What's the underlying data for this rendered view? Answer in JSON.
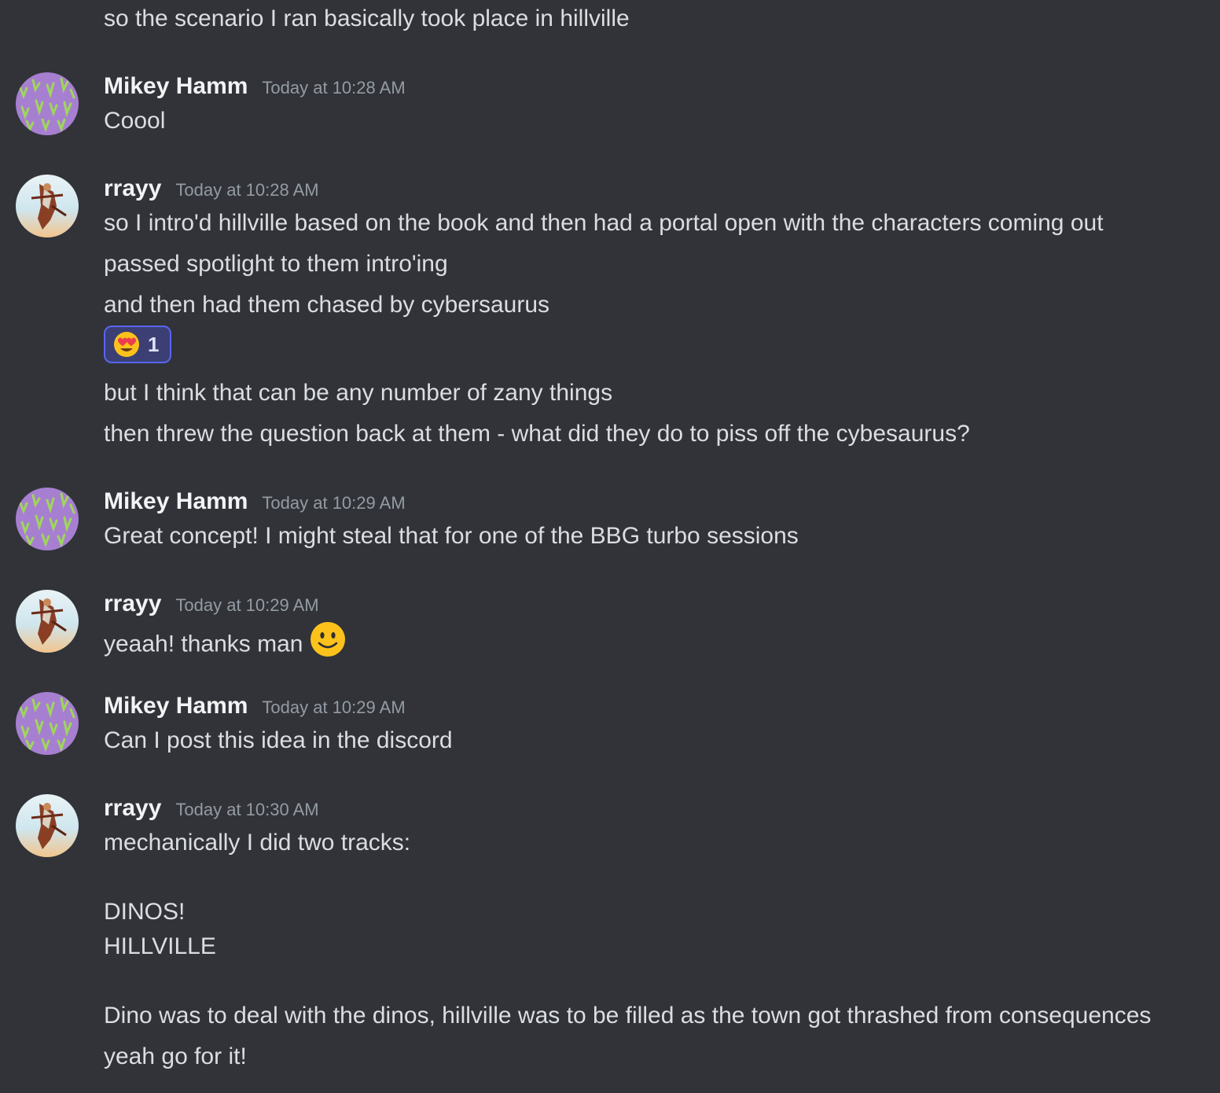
{
  "messages": {
    "m0": {
      "lines": [
        "so the scenario I ran basically took place in hillville"
      ]
    },
    "m1": {
      "author": "Mikey Hamm",
      "timestamp": "Today at 10:28 AM",
      "lines": [
        "Coool"
      ]
    },
    "m2": {
      "author": "rrayy",
      "timestamp": "Today at 10:28 AM",
      "lines": [
        "so I intro'd hillville based on the book and then had a portal open with the characters coming out",
        "passed spotlight to them intro'ing",
        "and then had them chased by cybersaurus"
      ],
      "reaction": {
        "emoji": "smiling-face-with-heart-eyes",
        "count": "1"
      },
      "lines_after": [
        "but I think that can be any number of zany things",
        "then threw the question back at them - what did they do to piss off the cybesaurus?"
      ]
    },
    "m3": {
      "author": "Mikey Hamm",
      "timestamp": "Today at 10:29 AM",
      "lines": [
        "Great concept! I might steal that for one of the BBG turbo sessions"
      ]
    },
    "m4": {
      "author": "rrayy",
      "timestamp": "Today at 10:29 AM",
      "lines": [
        "yeaah! thanks man"
      ],
      "emoji": "slightly-smiling-face"
    },
    "m5": {
      "author": "Mikey Hamm",
      "timestamp": "Today at 10:29 AM",
      "lines": [
        "Can I post this idea in the discord"
      ]
    },
    "m6": {
      "author": "rrayy",
      "timestamp": "Today at 10:30 AM",
      "lines": [
        "mechanically I did two tracks:",
        "DINOS!",
        "HILLVILLE",
        "Dino was to deal with the dinos, hillville was to be filled as the town got thrashed from consequences",
        "yeah go for it!"
      ]
    }
  },
  "colors": {
    "background": "#313338",
    "text": "#dbdee1",
    "author": "#f2f3f5",
    "timestamp": "#949ba4",
    "reaction_border": "#5865f2",
    "reaction_bg": "#3b3f74",
    "avatar_purple": "#a77fd1",
    "avatar_green": "#9fd65c"
  }
}
